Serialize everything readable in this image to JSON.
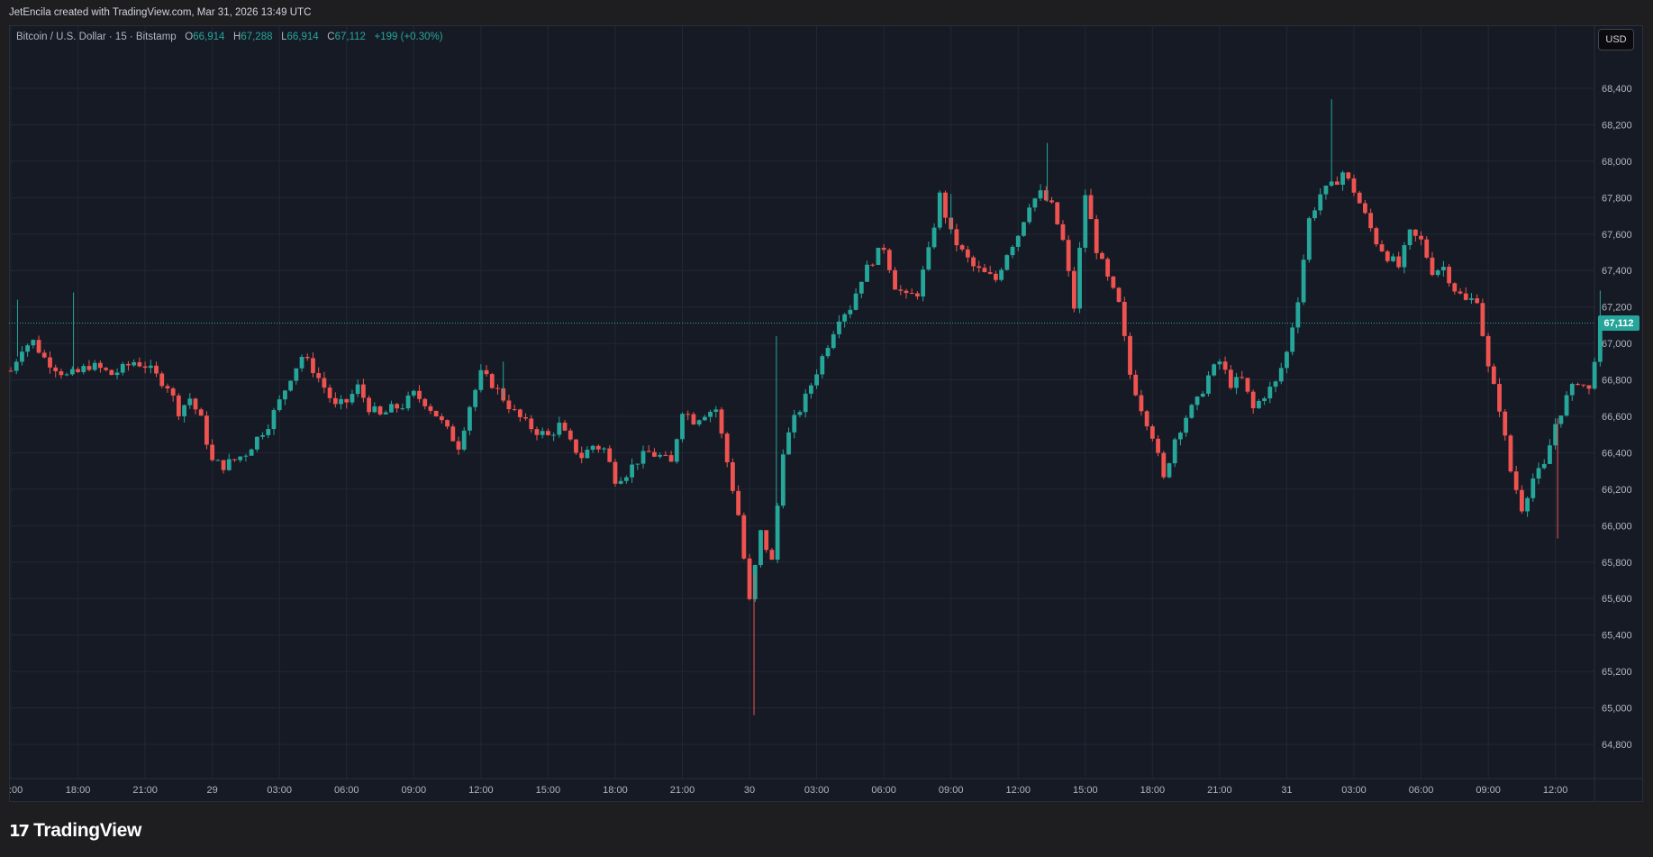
{
  "header": {
    "attribution": "JetEncila created with TradingView.com, Mar 31, 2026 13:49 UTC"
  },
  "legend": {
    "symbol": "Bitcoin / U.S. Dollar · 15 · Bitstamp",
    "open_label": "O",
    "open_value": "66,914",
    "high_label": "H",
    "high_value": "67,288",
    "low_label": "L",
    "low_value": "66,914",
    "close_label": "C",
    "close_value": "67,112",
    "change": "+199 (+0.30%)"
  },
  "currency_button": "USD",
  "last_price_label": "67,112",
  "logo_text": "TradingView",
  "colors": {
    "background": "#161a25",
    "up": "#26a69a",
    "down": "#ef5350",
    "grid": "#232734",
    "axis_text": "#b2b5be"
  },
  "chart_data": {
    "type": "candlestick",
    "title": "Bitcoin / U.S. Dollar · 15 · Bitstamp",
    "ylabel": "USD",
    "ylim": [
      64600,
      68600
    ],
    "y_ticks": [
      "64,800",
      "65,000",
      "65,200",
      "65,400",
      "65,600",
      "65,800",
      "66,000",
      "66,200",
      "66,400",
      "66,600",
      "66,800",
      "67,000",
      "67,200",
      "67,400",
      "67,600",
      "67,800",
      "68,000",
      "68,200",
      "68,400"
    ],
    "x_ticks": [
      ":00",
      "18:00",
      "21:00",
      "29",
      "03:00",
      "06:00",
      "09:00",
      "12:00",
      "15:00",
      "18:00",
      "21:00",
      "30",
      "03:00",
      "06:00",
      "09:00",
      "12:00",
      "15:00",
      "18:00",
      "21:00",
      "31",
      "03:00",
      "06:00",
      "09:00",
      "12:00"
    ],
    "x_ticks_hours": [
      15,
      18,
      21,
      24,
      27,
      30,
      33,
      36,
      39,
      42,
      45,
      48,
      51,
      54,
      57,
      60,
      63,
      66,
      69,
      72,
      75,
      78,
      81,
      84
    ],
    "last_price": 67112,
    "close_path": [
      [
        15.0,
        66850
      ],
      [
        15.5,
        66980
      ],
      [
        16.0,
        67010
      ],
      [
        16.5,
        66920
      ],
      [
        17.0,
        66870
      ],
      [
        17.5,
        66820
      ],
      [
        18.0,
        66840
      ],
      [
        18.5,
        66880
      ],
      [
        19.0,
        66860
      ],
      [
        19.5,
        66830
      ],
      [
        20.0,
        66860
      ],
      [
        20.5,
        66900
      ],
      [
        21.0,
        66880
      ],
      [
        21.5,
        66820
      ],
      [
        22.0,
        66770
      ],
      [
        22.5,
        66630
      ],
      [
        23.0,
        66700
      ],
      [
        23.5,
        66580
      ],
      [
        24.0,
        66350
      ],
      [
        24.5,
        66330
      ],
      [
        25.0,
        66360
      ],
      [
        25.5,
        66400
      ],
      [
        26.0,
        66480
      ],
      [
        26.5,
        66560
      ],
      [
        27.0,
        66680
      ],
      [
        27.5,
        66820
      ],
      [
        28.0,
        66930
      ],
      [
        28.5,
        66860
      ],
      [
        29.0,
        66760
      ],
      [
        29.5,
        66650
      ],
      [
        30.0,
        66680
      ],
      [
        30.5,
        66760
      ],
      [
        31.0,
        66650
      ],
      [
        31.5,
        66600
      ],
      [
        32.0,
        66640
      ],
      [
        32.5,
        66660
      ],
      [
        33.0,
        66720
      ],
      [
        33.5,
        66680
      ],
      [
        34.0,
        66610
      ],
      [
        34.5,
        66520
      ],
      [
        35.0,
        66440
      ],
      [
        35.5,
        66660
      ],
      [
        36.0,
        66830
      ],
      [
        36.5,
        66780
      ],
      [
        37.0,
        66700
      ],
      [
        37.5,
        66620
      ],
      [
        38.0,
        66560
      ],
      [
        38.5,
        66520
      ],
      [
        39.0,
        66490
      ],
      [
        39.5,
        66550
      ],
      [
        40.0,
        66450
      ],
      [
        40.5,
        66380
      ],
      [
        41.0,
        66440
      ],
      [
        41.5,
        66420
      ],
      [
        42.0,
        66260
      ],
      [
        42.5,
        66290
      ],
      [
        43.0,
        66360
      ],
      [
        43.5,
        66400
      ],
      [
        44.0,
        66380
      ],
      [
        44.5,
        66340
      ],
      [
        45.0,
        66640
      ],
      [
        45.5,
        66580
      ],
      [
        46.0,
        66620
      ],
      [
        46.5,
        66640
      ],
      [
        47.0,
        66350
      ],
      [
        47.5,
        66060
      ],
      [
        48.0,
        65580
      ],
      [
        48.5,
        65960
      ],
      [
        49.0,
        65800
      ],
      [
        49.5,
        66420
      ],
      [
        50.0,
        66580
      ],
      [
        50.5,
        66700
      ],
      [
        51.0,
        66850
      ],
      [
        51.5,
        67000
      ],
      [
        52.0,
        67150
      ],
      [
        52.5,
        67200
      ],
      [
        53.0,
        67360
      ],
      [
        53.5,
        67460
      ],
      [
        54.0,
        67530
      ],
      [
        54.5,
        67320
      ],
      [
        55.0,
        67250
      ],
      [
        55.5,
        67280
      ],
      [
        56.0,
        67500
      ],
      [
        56.5,
        67810
      ],
      [
        57.0,
        67600
      ],
      [
        57.5,
        67500
      ],
      [
        58.0,
        67420
      ],
      [
        58.5,
        67380
      ],
      [
        59.0,
        67350
      ],
      [
        59.5,
        67500
      ],
      [
        60.0,
        67600
      ],
      [
        60.5,
        67770
      ],
      [
        61.0,
        67820
      ],
      [
        61.5,
        67750
      ],
      [
        62.0,
        67560
      ],
      [
        62.5,
        67200
      ],
      [
        63.0,
        67820
      ],
      [
        63.5,
        67520
      ],
      [
        64.0,
        67350
      ],
      [
        64.5,
        67210
      ],
      [
        65.0,
        66830
      ],
      [
        65.5,
        66650
      ],
      [
        66.0,
        66500
      ],
      [
        66.5,
        66250
      ],
      [
        67.0,
        66480
      ],
      [
        67.5,
        66600
      ],
      [
        68.0,
        66680
      ],
      [
        68.5,
        66820
      ],
      [
        69.0,
        66900
      ],
      [
        69.5,
        66780
      ],
      [
        70.0,
        66800
      ],
      [
        70.5,
        66640
      ],
      [
        71.0,
        66720
      ],
      [
        71.5,
        66780
      ],
      [
        72.0,
        66950
      ],
      [
        72.5,
        67250
      ],
      [
        73.0,
        67680
      ],
      [
        73.5,
        67820
      ],
      [
        74.0,
        67860
      ],
      [
        74.5,
        67940
      ],
      [
        75.0,
        67840
      ],
      [
        75.5,
        67700
      ],
      [
        76.0,
        67560
      ],
      [
        76.5,
        67480
      ],
      [
        77.0,
        67420
      ],
      [
        77.5,
        67600
      ],
      [
        78.0,
        67560
      ],
      [
        78.5,
        67400
      ],
      [
        79.0,
        67420
      ],
      [
        79.5,
        67300
      ],
      [
        80.0,
        67230
      ],
      [
        80.5,
        67250
      ],
      [
        81.0,
        66860
      ],
      [
        81.5,
        66650
      ],
      [
        82.0,
        66300
      ],
      [
        82.5,
        66100
      ],
      [
        83.0,
        66260
      ],
      [
        83.5,
        66320
      ],
      [
        84.0,
        66560
      ],
      [
        84.5,
        66700
      ],
      [
        85.0,
        66800
      ],
      [
        85.5,
        66740
      ],
      [
        86.0,
        67112
      ]
    ],
    "extreme_wicks": [
      [
        15.3,
        67240,
        "high"
      ],
      [
        17.8,
        67280,
        "high"
      ],
      [
        37.0,
        66900,
        "high"
      ],
      [
        48.2,
        64960,
        "low"
      ],
      [
        49.2,
        67040,
        "high"
      ],
      [
        57.0,
        67820,
        "high"
      ],
      [
        61.3,
        68100,
        "high"
      ],
      [
        74.0,
        68340,
        "high"
      ],
      [
        84.1,
        65930,
        "low"
      ],
      [
        86.0,
        67290,
        "high"
      ]
    ]
  }
}
